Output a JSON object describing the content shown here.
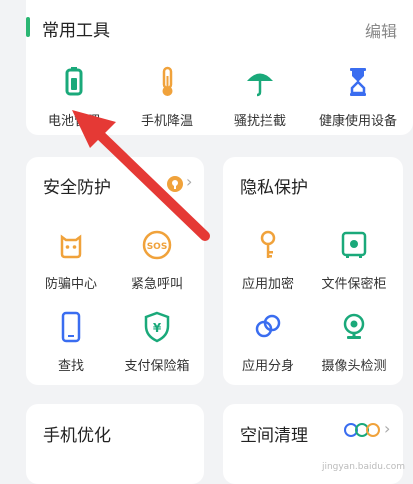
{
  "tools": {
    "title": "常用工具",
    "edit": "编辑",
    "items": [
      {
        "label": "电池管理",
        "icon": "battery-icon",
        "color": "#1aa97a"
      },
      {
        "label": "手机降温",
        "icon": "thermometer-icon",
        "color": "#f0a23b"
      },
      {
        "label": "骚扰拦截",
        "icon": "umbrella-icon",
        "color": "#1aa97a"
      },
      {
        "label": "健康使用设备",
        "icon": "hourglass-icon",
        "color": "#3a6df0"
      }
    ]
  },
  "security": {
    "title": "安全防护",
    "items": [
      {
        "label": "防骗中心",
        "icon": "robot-icon",
        "color": "#f0a23b"
      },
      {
        "label": "紧急呼叫",
        "icon": "sos-icon",
        "color": "#f0a23b"
      },
      {
        "label": "查找",
        "icon": "phone-icon",
        "color": "#3a6df0"
      },
      {
        "label": "支付保险箱",
        "icon": "shield-yen-icon",
        "color": "#1aa97a"
      }
    ]
  },
  "privacy": {
    "title": "隐私保护",
    "items": [
      {
        "label": "应用加密",
        "icon": "key-icon",
        "color": "#f0a23b"
      },
      {
        "label": "文件保密柜",
        "icon": "safe-icon",
        "color": "#1aa97a"
      },
      {
        "label": "应用分身",
        "icon": "link-icon",
        "color": "#3a6df0"
      },
      {
        "label": "摄像头检测",
        "icon": "camera-icon",
        "color": "#1aa97a"
      }
    ]
  },
  "optimize": {
    "title": "手机优化"
  },
  "clean": {
    "title": "空间清理"
  },
  "watermark": "jingyan.baidu.com",
  "annotation_color": "#e53935"
}
